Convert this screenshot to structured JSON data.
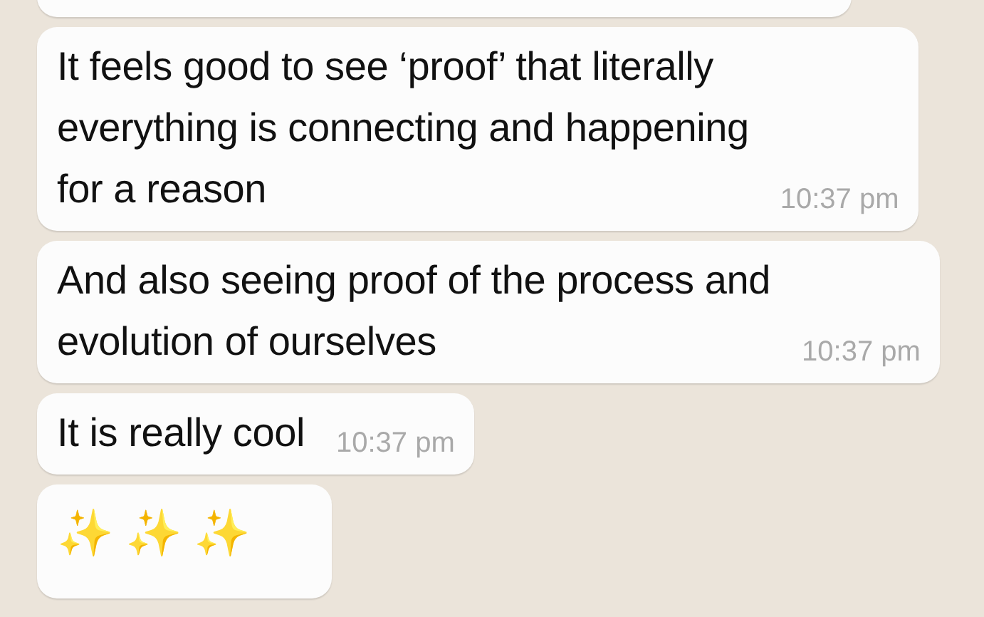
{
  "messages": [
    {
      "kind": "text"
    },
    {
      "kind": "text",
      "text": "It feels good to see ‘proof’ that literally\neverything is connecting and happening\nfor a reason",
      "time": "10:37 pm"
    },
    {
      "kind": "text",
      "text": "And also seeing proof of the process and\nevolution of ourselves",
      "time": "10:37 pm"
    },
    {
      "kind": "text",
      "text": "It is really cool",
      "time": "10:37 pm"
    },
    {
      "kind": "emoji",
      "text": "✨✨✨"
    }
  ]
}
